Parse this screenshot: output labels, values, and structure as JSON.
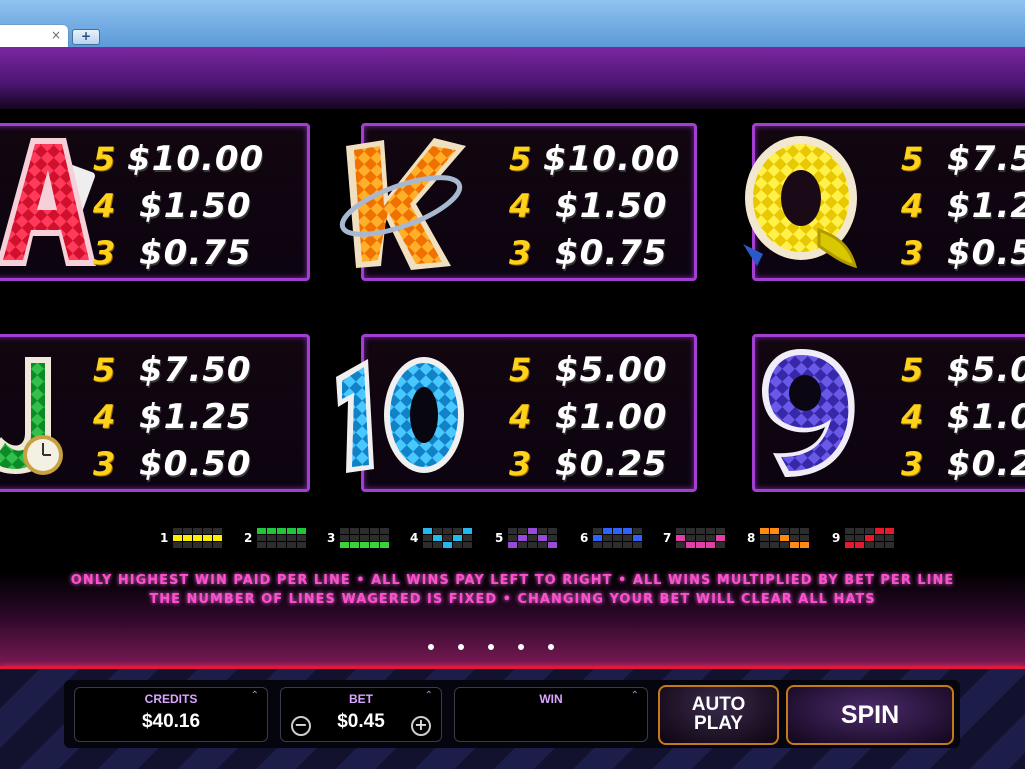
{
  "browser": {
    "tab_close": "×",
    "new_tab": "+"
  },
  "paytable": {
    "cards": [
      {
        "symbol": "A",
        "color": "#e6163a",
        "rows": [
          {
            "n": "5",
            "v": "$10.00"
          },
          {
            "n": "4",
            "v": "$1.50"
          },
          {
            "n": "3",
            "v": "$0.75"
          }
        ]
      },
      {
        "symbol": "K",
        "color": "#ff8a10",
        "rows": [
          {
            "n": "5",
            "v": "$10.00"
          },
          {
            "n": "4",
            "v": "$1.50"
          },
          {
            "n": "3",
            "v": "$0.75"
          }
        ]
      },
      {
        "symbol": "Q",
        "color": "#ffe21a",
        "rows": [
          {
            "n": "5",
            "v": "$7.5"
          },
          {
            "n": "4",
            "v": "$1.2"
          },
          {
            "n": "3",
            "v": "$0.5"
          }
        ]
      },
      {
        "symbol": "J",
        "color": "#1ea83a",
        "rows": [
          {
            "n": "5",
            "v": "$7.50"
          },
          {
            "n": "4",
            "v": "$1.25"
          },
          {
            "n": "3",
            "v": "$0.50"
          }
        ]
      },
      {
        "symbol": "10",
        "color": "#27a6e8",
        "rows": [
          {
            "n": "5",
            "v": "$5.00"
          },
          {
            "n": "4",
            "v": "$1.00"
          },
          {
            "n": "3",
            "v": "$0.25"
          }
        ]
      },
      {
        "symbol": "9",
        "color": "#4a3ac8",
        "rows": [
          {
            "n": "5",
            "v": "$5.0"
          },
          {
            "n": "4",
            "v": "$1.0"
          },
          {
            "n": "3",
            "v": "$0.2"
          }
        ]
      }
    ]
  },
  "lines": [
    {
      "num": "1",
      "color": "#ffee00",
      "pattern": [
        1,
        1,
        1,
        1,
        1
      ]
    },
    {
      "num": "2",
      "color": "#1ec83a",
      "pattern": [
        0,
        0,
        0,
        0,
        0
      ]
    },
    {
      "num": "3",
      "color": "#3cd23c",
      "pattern": [
        2,
        2,
        2,
        2,
        2
      ]
    },
    {
      "num": "4",
      "color": "#25b8ef",
      "pattern": [
        0,
        1,
        2,
        1,
        0
      ]
    },
    {
      "num": "5",
      "color": "#9a4ad8",
      "pattern": [
        2,
        1,
        0,
        1,
        2
      ]
    },
    {
      "num": "6",
      "color": "#2f62ff",
      "pattern": [
        1,
        0,
        0,
        0,
        1
      ]
    },
    {
      "num": "7",
      "color": "#e040a8",
      "pattern": [
        1,
        2,
        2,
        2,
        1
      ]
    },
    {
      "num": "8",
      "color": "#ff8a14",
      "pattern": [
        0,
        0,
        1,
        2,
        2
      ]
    },
    {
      "num": "9",
      "color": "#e8182e",
      "pattern": [
        2,
        2,
        1,
        0,
        0
      ]
    }
  ],
  "rules": {
    "line1": "ONLY HIGHEST WIN PAID PER LINE • ALL WINS PAY LEFT TO RIGHT • ALL WINS MULTIPLIED BY BET PER LINE",
    "line2": "THE NUMBER OF LINES WAGERED IS FIXED • CHANGING YOUR BET WILL CLEAR ALL HATS"
  },
  "pagination": {
    "pages": 5
  },
  "controls": {
    "credits_label": "CREDITS",
    "credits_value": "$40.16",
    "bet_label": "BET",
    "bet_value": "$0.45",
    "bet_minus": "−",
    "bet_plus": "+",
    "win_label": "WIN",
    "win_value": "",
    "expand": "⌃",
    "autoplay_line1": "AUTO",
    "autoplay_line2": "PLAY",
    "spin_label": "SPIN"
  }
}
